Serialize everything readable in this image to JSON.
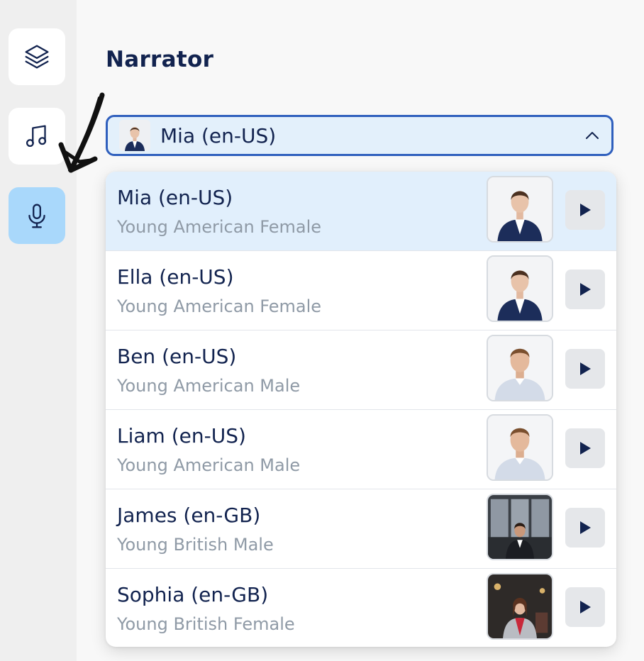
{
  "sidebar": {
    "items": [
      {
        "icon": "layers-icon",
        "active": false
      },
      {
        "icon": "music-note-icon",
        "active": false
      },
      {
        "icon": "microphone-icon",
        "active": true
      }
    ]
  },
  "narrator": {
    "title": "Narrator",
    "selected": "Mia (en-US)",
    "options": [
      {
        "name": "Mia (en-US)",
        "description": "Young American Female",
        "thumb": "female-suit"
      },
      {
        "name": "Ella (en-US)",
        "description": "Young American Female",
        "thumb": "female-suit"
      },
      {
        "name": "Ben (en-US)",
        "description": "Young American Male",
        "thumb": "male-shirt"
      },
      {
        "name": "Liam (en-US)",
        "description": "Young American Male",
        "thumb": "male-shirt"
      },
      {
        "name": "James (en-GB)",
        "description": "Young British Male",
        "thumb": "male-office"
      },
      {
        "name": "Sophia (en-GB)",
        "description": "Young British Female",
        "thumb": "female-office"
      }
    ]
  },
  "colors": {
    "accent": "#2f5fbd",
    "selected_bg": "#e1effc",
    "active_rail": "#a9d8fb",
    "text": "#12234f",
    "muted": "#8f9aa6"
  }
}
